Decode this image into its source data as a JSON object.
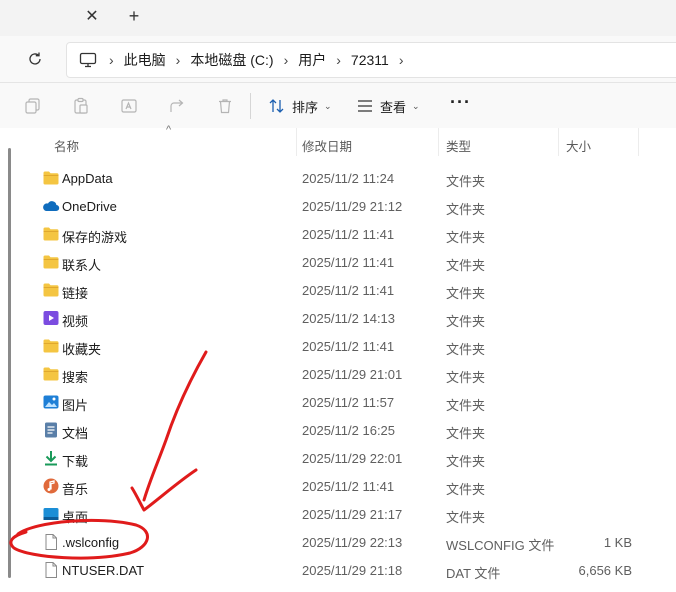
{
  "tabs": {
    "close_glyph": "✕",
    "new_glyph": "+"
  },
  "breadcrumb": {
    "separator": "›",
    "items": [
      "此电脑",
      "本地磁盘 (C:)",
      "用户",
      "72311"
    ]
  },
  "commandbar": {
    "sort_label": "排序",
    "view_label": "查看",
    "more_label": "···"
  },
  "columns": {
    "name": "名称",
    "date": "修改日期",
    "type": "类型",
    "size": "大小"
  },
  "files": [
    {
      "name": "AppData",
      "date": "2025/11/2 11:24",
      "type": "文件夹",
      "size": "",
      "icon": "folder-icon"
    },
    {
      "name": "OneDrive",
      "date": "2025/11/29 21:12",
      "type": "文件夹",
      "size": "",
      "icon": "onedrive-icon"
    },
    {
      "name": "保存的游戏",
      "date": "2025/11/2 11:41",
      "type": "文件夹",
      "size": "",
      "icon": "folder-icon"
    },
    {
      "name": "联系人",
      "date": "2025/11/2 11:41",
      "type": "文件夹",
      "size": "",
      "icon": "folder-icon"
    },
    {
      "name": "链接",
      "date": "2025/11/2 11:41",
      "type": "文件夹",
      "size": "",
      "icon": "folder-icon"
    },
    {
      "name": "视频",
      "date": "2025/11/2 14:13",
      "type": "文件夹",
      "size": "",
      "icon": "videos-folder-icon"
    },
    {
      "name": "收藏夹",
      "date": "2025/11/2 11:41",
      "type": "文件夹",
      "size": "",
      "icon": "folder-icon"
    },
    {
      "name": "搜索",
      "date": "2025/11/29 21:01",
      "type": "文件夹",
      "size": "",
      "icon": "folder-icon"
    },
    {
      "name": "图片",
      "date": "2025/11/2 11:57",
      "type": "文件夹",
      "size": "",
      "icon": "pictures-folder-icon"
    },
    {
      "name": "文档",
      "date": "2025/11/2 16:25",
      "type": "文件夹",
      "size": "",
      "icon": "documents-folder-icon"
    },
    {
      "name": "下载",
      "date": "2025/11/29 22:01",
      "type": "文件夹",
      "size": "",
      "icon": "downloads-folder-icon"
    },
    {
      "name": "音乐",
      "date": "2025/11/2 11:41",
      "type": "文件夹",
      "size": "",
      "icon": "music-folder-icon"
    },
    {
      "name": "桌面",
      "date": "2025/11/29 21:17",
      "type": "文件夹",
      "size": "",
      "icon": "desktop-folder-icon"
    },
    {
      "name": ".wslconfig",
      "date": "2025/11/29 22:13",
      "type": "WSLCONFIG 文件",
      "size": "1 KB",
      "icon": "file-icon"
    },
    {
      "name": "NTUSER.DAT",
      "date": "2025/11/29 21:18",
      "type": "DAT 文件",
      "size": "6,656 KB",
      "icon": "file-icon"
    }
  ],
  "colors": {
    "folder": "#f4c542",
    "folder_dark": "#e0a82e",
    "onedrive": "#0f6cbd",
    "annotation": "#e01b1b"
  }
}
